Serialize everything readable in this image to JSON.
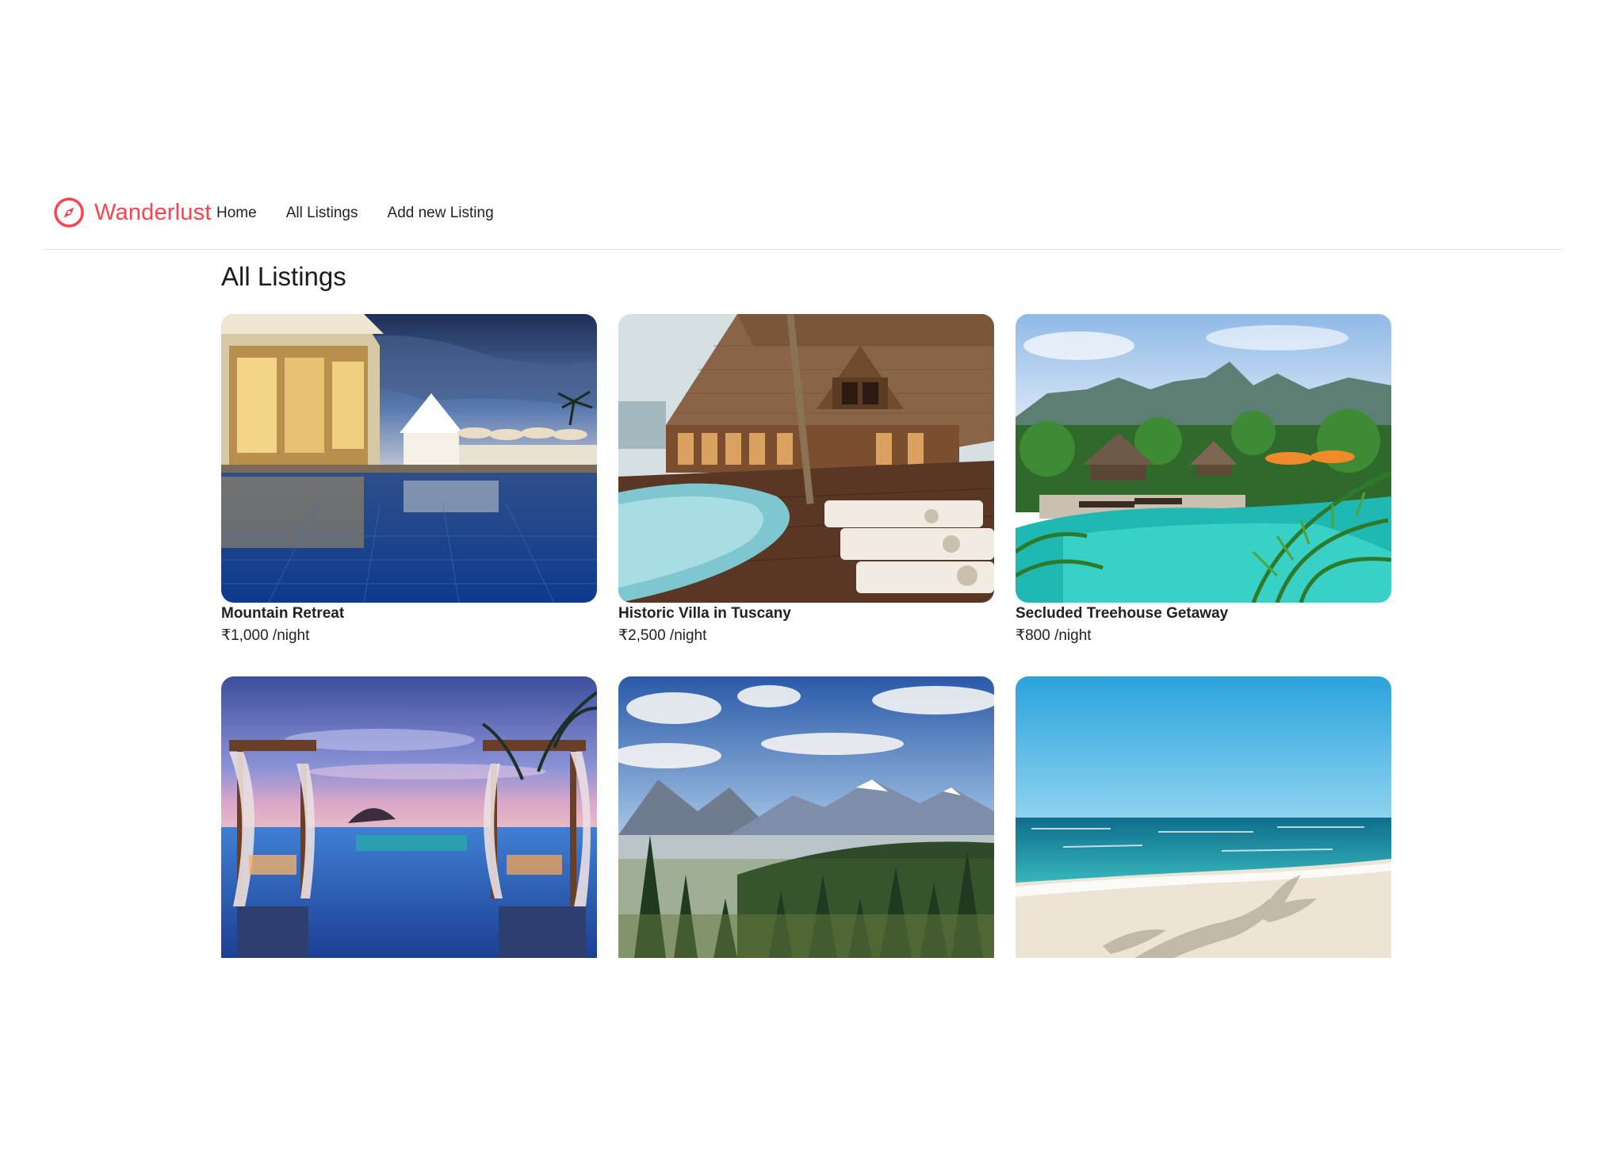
{
  "brand": {
    "name": "Wanderlust",
    "icon": "compass-icon",
    "color": "#fe424d"
  },
  "nav": {
    "links": [
      {
        "label": "Home"
      },
      {
        "label": "All Listings"
      },
      {
        "label": "Add new Listing"
      }
    ]
  },
  "page": {
    "title": "All Listings"
  },
  "listings": [
    {
      "title": "Mountain Retreat",
      "price": "₹1,000",
      "unit": " /night",
      "image": "resort-pool-dusk-image"
    },
    {
      "title": "Historic Villa in Tuscany",
      "price": "₹2,500",
      "unit": " /night",
      "image": "wooden-lodge-pool-image"
    },
    {
      "title": "Secluded Treehouse Getaway",
      "price": "₹800",
      "unit": " /night",
      "image": "tropical-pool-image"
    },
    {
      "title": "",
      "price": "",
      "unit": "",
      "image": "cabana-pool-sunset-image"
    },
    {
      "title": "",
      "price": "",
      "unit": "",
      "image": "mountain-valley-image"
    },
    {
      "title": "",
      "price": "",
      "unit": "",
      "image": "beach-shore-image"
    }
  ]
}
